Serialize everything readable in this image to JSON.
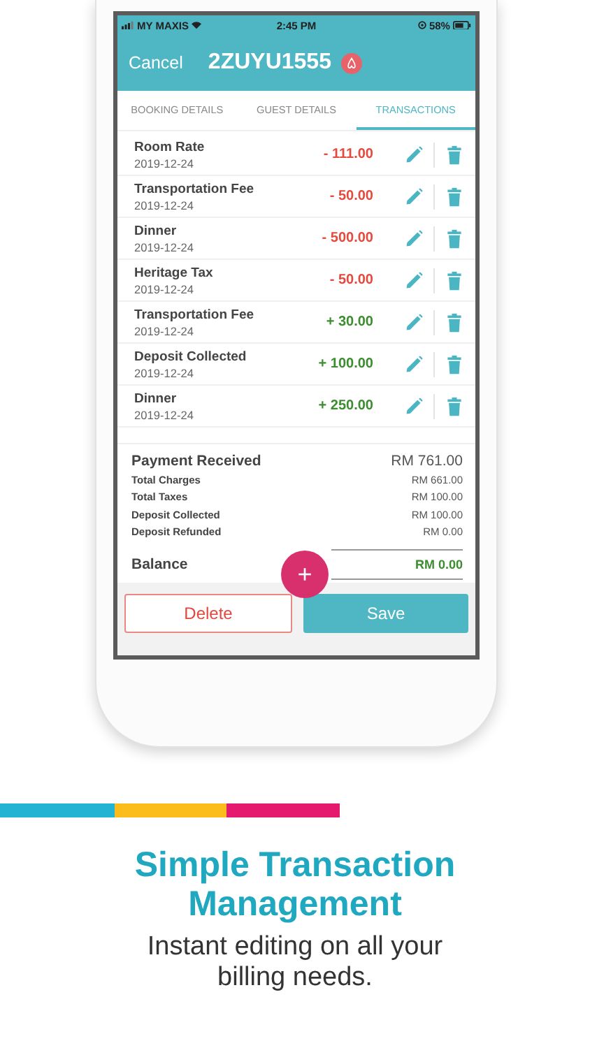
{
  "status_bar": {
    "carrier": "MY MAXIS",
    "time": "2:45 PM",
    "battery": "58%"
  },
  "header": {
    "cancel": "Cancel",
    "title": "2ZUYU1555"
  },
  "tabs": [
    {
      "label": "BOOKING DETAILS",
      "selected": false
    },
    {
      "label": "GUEST DETAILS",
      "selected": false
    },
    {
      "label": "TRANSACTIONS",
      "selected": true
    }
  ],
  "transactions": [
    {
      "name": "Room Rate",
      "date": "2019-12-24",
      "amount": "- 111.00",
      "kind": "charge"
    },
    {
      "name": "Transportation Fee",
      "date": "2019-12-24",
      "amount": "- 50.00",
      "kind": "charge"
    },
    {
      "name": "Dinner",
      "date": "2019-12-24",
      "amount": "- 500.00",
      "kind": "charge"
    },
    {
      "name": "Heritage Tax",
      "date": "2019-12-24",
      "amount": "- 50.00",
      "kind": "charge"
    },
    {
      "name": "Transportation Fee",
      "date": "2019-12-24",
      "amount": "+ 30.00",
      "kind": "credit"
    },
    {
      "name": "Deposit Collected",
      "date": "2019-12-24",
      "amount": "+ 100.00",
      "kind": "credit"
    },
    {
      "name": "Dinner",
      "date": "2019-12-24",
      "amount": "+ 250.00",
      "kind": "credit"
    }
  ],
  "summary": {
    "payment_received": {
      "label": "Payment Received",
      "value": "RM 761.00"
    },
    "lines": [
      {
        "label": "Total Charges",
        "value": "RM 661.00"
      },
      {
        "label": "Total Taxes",
        "value": "RM 100.00"
      },
      {
        "label": "Deposit Collected",
        "value": "RM 100.00"
      },
      {
        "label": "Deposit Refunded",
        "value": "RM 0.00"
      }
    ],
    "balance": {
      "label": "Balance",
      "value": "RM 0.00"
    }
  },
  "add_button": "+",
  "buttons": {
    "delete": "Delete",
    "save": "Save"
  },
  "headline": "Simple Transaction Management",
  "subtitle": "Instant editing on all your billing needs."
}
